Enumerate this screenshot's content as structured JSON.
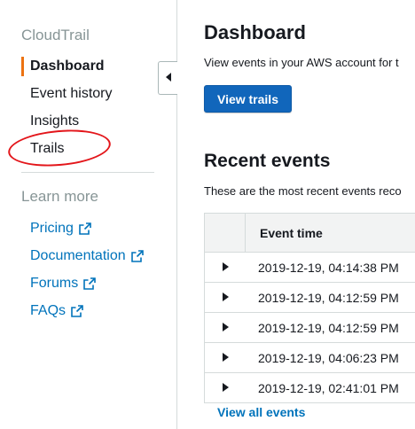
{
  "sidebar": {
    "title": "CloudTrail",
    "nav": [
      {
        "label": "Dashboard"
      },
      {
        "label": "Event history"
      },
      {
        "label": "Insights"
      },
      {
        "label": "Trails"
      }
    ],
    "section_title": "Learn more",
    "links": [
      {
        "label": "Pricing"
      },
      {
        "label": "Documentation"
      },
      {
        "label": "Forums"
      },
      {
        "label": "FAQs"
      }
    ]
  },
  "main": {
    "dashboard_title": "Dashboard",
    "dashboard_desc": "View events in your AWS account for t",
    "view_trails_label": "View trails",
    "recent_title": "Recent events",
    "recent_desc": "These are the most recent events reco",
    "table": {
      "headers": [
        "Event time"
      ],
      "rows": [
        {
          "event_time": "2019-12-19, 04:14:38 PM"
        },
        {
          "event_time": "2019-12-19, 04:12:59 PM"
        },
        {
          "event_time": "2019-12-19, 04:12:59 PM"
        },
        {
          "event_time": "2019-12-19, 04:06:23 PM"
        },
        {
          "event_time": "2019-12-19, 02:41:01 PM"
        }
      ]
    },
    "view_all_label": "View all events"
  },
  "colors": {
    "accent": "#ec7211",
    "link": "#0073bb",
    "primary_button": "#1166bb",
    "annotation": "#e3151a"
  },
  "icons": {
    "collapse": "caret-left-icon",
    "external": "external-link-icon",
    "expand_row": "caret-right-icon"
  }
}
